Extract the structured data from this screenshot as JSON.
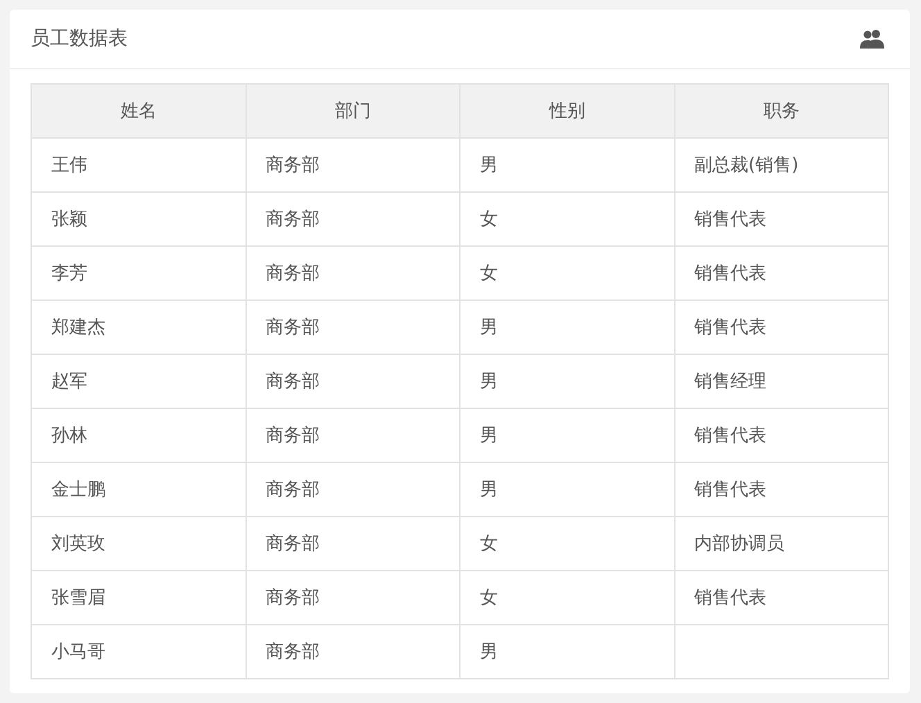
{
  "panel": {
    "title": "员工数据表"
  },
  "table": {
    "columns": [
      "姓名",
      "部门",
      "性别",
      "职务"
    ],
    "rows": [
      [
        "王伟",
        "商务部",
        "男",
        "副总裁(销售)"
      ],
      [
        "张颖",
        "商务部",
        "女",
        "销售代表"
      ],
      [
        "李芳",
        "商务部",
        "女",
        "销售代表"
      ],
      [
        "郑建杰",
        "商务部",
        "男",
        "销售代表"
      ],
      [
        "赵军",
        "商务部",
        "男",
        "销售经理"
      ],
      [
        "孙林",
        "商务部",
        "男",
        "销售代表"
      ],
      [
        "金士鹏",
        "商务部",
        "男",
        "销售代表"
      ],
      [
        "刘英玫",
        "商务部",
        "女",
        "内部协调员"
      ],
      [
        "张雪眉",
        "商务部",
        "女",
        "销售代表"
      ],
      [
        "小马哥",
        "商务部",
        "男"
      ]
    ]
  }
}
